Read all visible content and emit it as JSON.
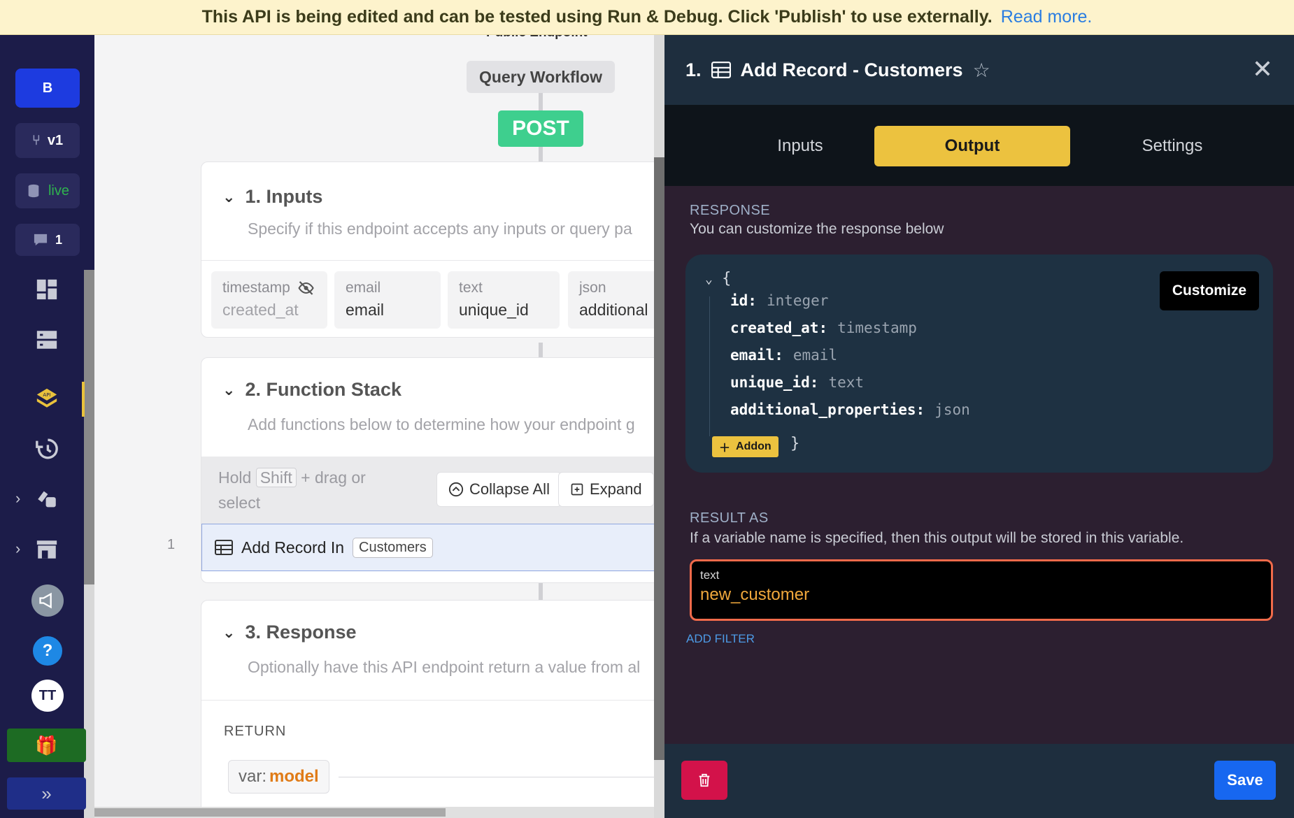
{
  "banner": {
    "message": "This API is being edited and can be tested using Run & Debug. Click 'Publish' to use externally.",
    "link": "Read more."
  },
  "rail": {
    "workspace_letter": "B",
    "branch": "v1",
    "datasource": "live",
    "comments_count": "1",
    "user_initials": "TT",
    "icons": [
      "dashboard-icon",
      "database-icon",
      "api-icon",
      "history-icon",
      "addons-icon",
      "marketplace-icon",
      "megaphone-icon",
      "help-icon",
      "gift-icon",
      "expand-icon"
    ],
    "colors": {
      "accent": "#1d3be0",
      "live": "#2fb24e",
      "active_marker": "#e9c23c"
    }
  },
  "canvas": {
    "public_endpoint": "Public Endpoint",
    "query_workflow": "Query Workflow",
    "method": "POST",
    "inputs": {
      "title": "1. Inputs",
      "subtitle": "Specify if this endpoint accepts any inputs or query pa",
      "chips": [
        {
          "type": "timestamp",
          "name": "created_at",
          "hidden": true
        },
        {
          "type": "email",
          "name": "email"
        },
        {
          "type": "text",
          "name": "unique_id"
        },
        {
          "type": "json",
          "name": "additional"
        }
      ]
    },
    "function_stack": {
      "title": "2. Function Stack",
      "subtitle": "Add functions below to determine how your endpoint g",
      "hint_prefix": "Hold",
      "hint_key": "Shift",
      "hint_suffix": "+ drag or select",
      "collapse_all": "Collapse All",
      "expand": "Expand",
      "rows": [
        {
          "number": "1",
          "label": "Add Record In",
          "table": "Customers"
        }
      ]
    },
    "response": {
      "title": "3. Response",
      "subtitle": "Optionally have this API endpoint return a value from al",
      "return_label": "RETURN",
      "var_prefix": "var:",
      "var_name": "model"
    }
  },
  "panel": {
    "step": "1.",
    "title": "Add Record - Customers",
    "tabs": [
      {
        "label": "Inputs",
        "active": false
      },
      {
        "label": "Output",
        "active": true
      },
      {
        "label": "Settings",
        "active": false
      }
    ],
    "response": {
      "label": "RESPONSE",
      "description": "You can customize the response below",
      "customize": "Customize",
      "open_brace": "{",
      "close_brace": "}",
      "fields": [
        {
          "key": "id",
          "type": "integer"
        },
        {
          "key": "created_at",
          "type": "timestamp"
        },
        {
          "key": "email",
          "type": "email"
        },
        {
          "key": "unique_id",
          "type": "text"
        },
        {
          "key": "additional_properties",
          "type": "json"
        }
      ],
      "addon": "Addon"
    },
    "result": {
      "label": "RESULT AS",
      "description": "If a variable name is specified, then this output will be stored in this variable.",
      "input_type": "text",
      "input_value": "new_customer",
      "add_filter": "ADD FILTER"
    },
    "footer": {
      "save": "Save"
    },
    "colors": {
      "tab_active": "#ecc23f",
      "input_border": "#f06a4a",
      "save": "#1767f0",
      "delete": "#d3124a"
    }
  }
}
